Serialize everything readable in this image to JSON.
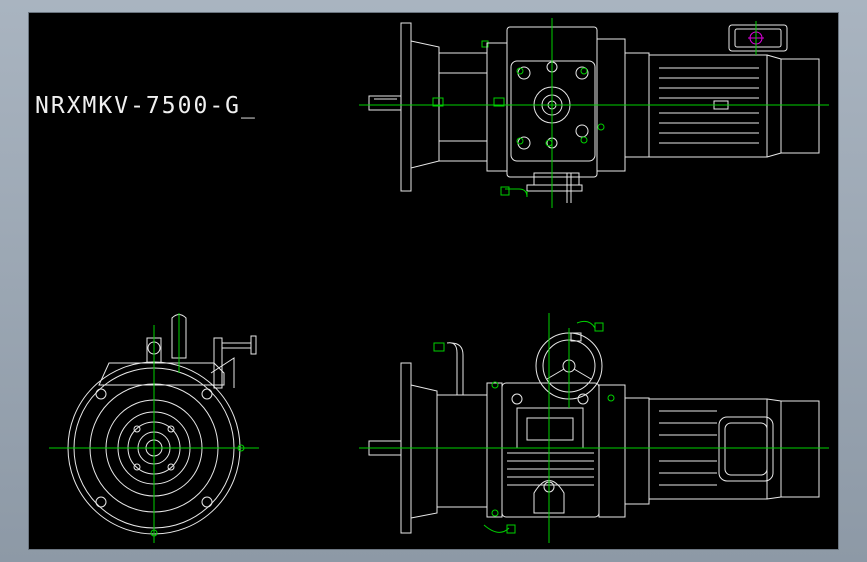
{
  "drawing": {
    "label": "NRXMKV-7500-G_",
    "colors": {
      "background": "#000000",
      "frame": "#9aa5b1",
      "outline": "#e8e8e8",
      "centerline": "#00d000",
      "accent_yellow": "#e8e800",
      "accent_magenta": "#e000e0"
    },
    "views": [
      "top-view",
      "end-view",
      "front-view"
    ]
  }
}
